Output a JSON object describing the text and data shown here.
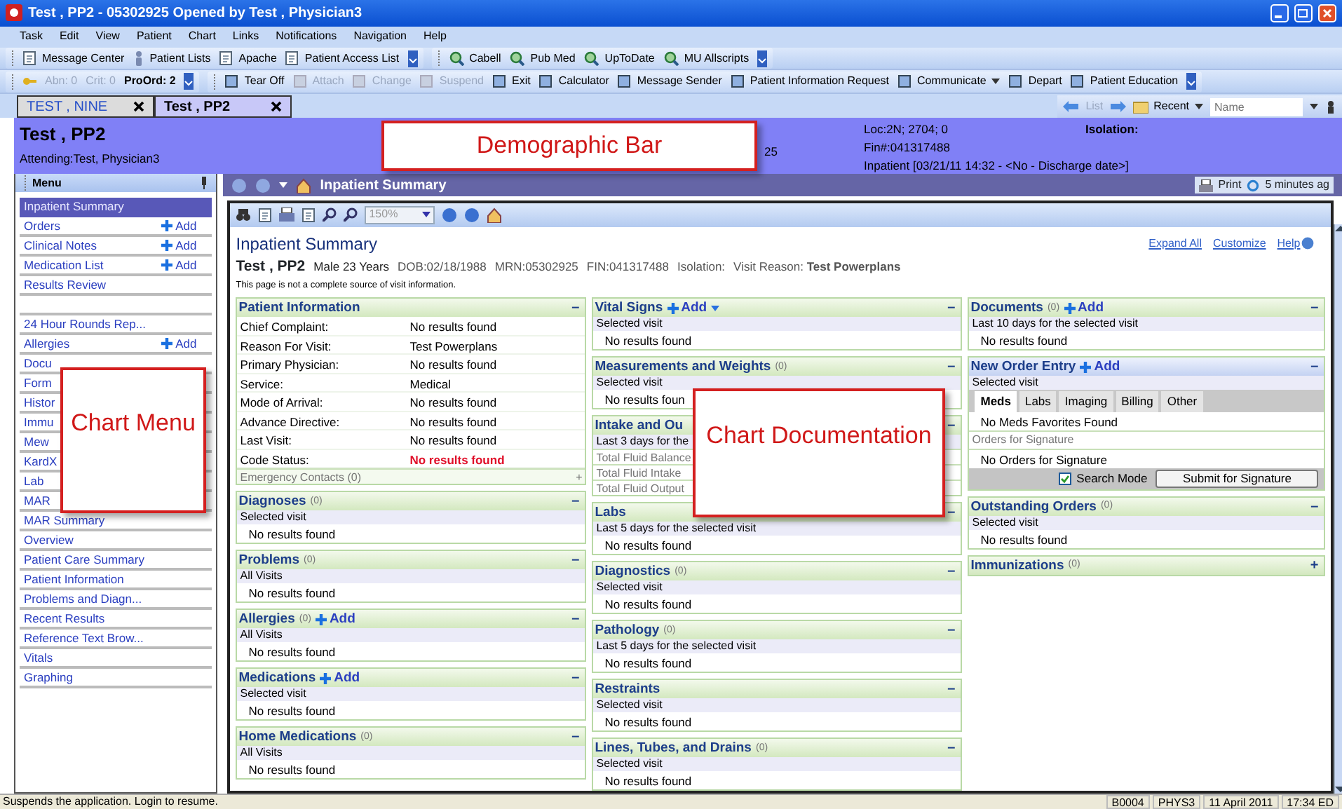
{
  "window": {
    "title": "Test , PP2 - 05302925 Opened by Test , Physician3"
  },
  "menubar": [
    "Task",
    "Edit",
    "View",
    "Patient",
    "Chart",
    "Links",
    "Notifications",
    "Navigation",
    "Help"
  ],
  "toolbar_1": [
    "Message Center",
    "Patient Lists",
    "Apache",
    "Patient Access List"
  ],
  "reference_links": [
    "Cabell",
    "Pub Med",
    "UpToDate",
    "MU Allscripts"
  ],
  "alerts": {
    "abnormal": "Abn: 0",
    "critical": "Crit: 0",
    "proposed_orders": "ProOrd: 2"
  },
  "toolbar_2": [
    {
      "label": "Tear Off",
      "disabled": false,
      "dropdown": false
    },
    {
      "label": "Attach",
      "disabled": true,
      "dropdown": false
    },
    {
      "label": "Change",
      "disabled": true,
      "dropdown": false
    },
    {
      "label": "Suspend",
      "disabled": true,
      "dropdown": false
    },
    {
      "label": "Exit",
      "disabled": false,
      "dropdown": false
    },
    {
      "label": "Calculator",
      "disabled": false,
      "dropdown": false
    },
    {
      "label": "Message Sender",
      "disabled": false,
      "dropdown": false
    },
    {
      "label": "Patient Information Request",
      "disabled": false,
      "dropdown": false
    },
    {
      "label": "Communicate",
      "disabled": false,
      "dropdown": true
    },
    {
      "label": "Depart",
      "disabled": false,
      "dropdown": false
    },
    {
      "label": "Patient Education",
      "disabled": false,
      "dropdown": false
    }
  ],
  "patient_tabs": [
    {
      "label": "TEST , NINE",
      "selected": false
    },
    {
      "label": "Test , PP2",
      "selected": true
    }
  ],
  "patient_nav": {
    "list": "List",
    "recent": "Recent",
    "placeholder": "Name"
  },
  "demographics": {
    "name": "Test , PP2",
    "attending": "Attending:Test, Physician3",
    "partial": "25",
    "location": "Loc:2N; 2704; 0",
    "fin": "Fin#:041317488",
    "encounter": "Inpatient [03/21/11 14:32 - <No - Discharge date>]",
    "isolation": "Isolation:",
    "callout": "Demographic Bar"
  },
  "chart_menu": {
    "title": "Menu",
    "callout": "Chart Menu",
    "items": [
      {
        "kind": "item",
        "label": "Inpatient Summary",
        "selected": true
      },
      {
        "kind": "item",
        "label": "Orders",
        "selected": false,
        "add": "Add"
      },
      {
        "kind": "item",
        "label": "Clinical Notes",
        "selected": false,
        "add": "Add"
      },
      {
        "kind": "item",
        "label": "Medication List",
        "selected": false,
        "add": "Add"
      },
      {
        "kind": "item",
        "label": "Results Review",
        "selected": false
      },
      {
        "kind": "spacer"
      },
      {
        "kind": "item",
        "label": "24 Hour Rounds Rep...",
        "selected": false
      },
      {
        "kind": "item",
        "label": "Allergies",
        "selected": false,
        "add": "Add"
      },
      {
        "kind": "item",
        "label": "Docu",
        "selected": false
      },
      {
        "kind": "item",
        "label": "Form",
        "selected": false
      },
      {
        "kind": "item",
        "label": "Histor",
        "selected": false
      },
      {
        "kind": "item",
        "label": "Immu",
        "selected": false
      },
      {
        "kind": "item",
        "label": "Mew",
        "selected": false
      },
      {
        "kind": "item",
        "label": "KardX",
        "selected": false
      },
      {
        "kind": "item",
        "label": "Lab",
        "selected": false
      },
      {
        "kind": "item",
        "label": "MAR",
        "selected": false
      },
      {
        "kind": "item",
        "label": "MAR Summary",
        "selected": false
      },
      {
        "kind": "item",
        "label": "Overview",
        "selected": false
      },
      {
        "kind": "item",
        "label": "Patient Care Summary",
        "selected": false
      },
      {
        "kind": "item",
        "label": "Patient Information",
        "selected": false
      },
      {
        "kind": "item",
        "label": "Problems and Diagn...",
        "selected": false
      },
      {
        "kind": "item",
        "label": "Recent Results",
        "selected": false
      },
      {
        "kind": "item",
        "label": "Reference Text Brow...",
        "selected": false
      },
      {
        "kind": "item",
        "label": "Vitals",
        "selected": false
      },
      {
        "kind": "item",
        "label": "Graphing",
        "selected": false
      }
    ]
  },
  "main": {
    "title": "Inpatient Summary",
    "print": "Print",
    "refresh": "5 minutes ag",
    "zoom": "150%"
  },
  "summary": {
    "title": "Inpatient Summary",
    "links": [
      "Expand All",
      "Customize",
      "Help"
    ],
    "patient_name": "Test , PP2",
    "details": [
      "Male 23 Years",
      "DOB:02/18/1988",
      "MRN:05302925",
      "FIN:041317488",
      "Isolation:",
      "Visit Reason: **Test Powerplans**"
    ],
    "disclaimer": "This page is not a complete source of visit information.",
    "callout": "Chart Documentation",
    "columns": [
      [
        {
          "kind": "details",
          "title": "Patient Information",
          "toggle": "–",
          "rows": [
            {
              "label": "Chief Complaint:",
              "value": "No results found",
              "alert": false
            },
            {
              "label": "Reason For Visit:",
              "value": "Test Powerplans",
              "alert": false
            },
            {
              "label": "Primary Physician:",
              "value": "No results found",
              "alert": false
            },
            {
              "label": "Service:",
              "value": "Medical",
              "alert": false
            },
            {
              "label": "Mode of Arrival:",
              "value": "No results found",
              "alert": false
            },
            {
              "label": "Advance Directive:",
              "value": "No results found",
              "alert": false
            },
            {
              "label": "Last Visit:",
              "value": "No results found",
              "alert": false
            },
            {
              "label": "Code Status:",
              "value": "No results found",
              "alert": true
            }
          ],
          "footer": {
            "label": "Emergency Contacts (0)",
            "toggle": "+"
          }
        },
        {
          "kind": "list",
          "title": "Diagnoses",
          "count": "(0)",
          "toggle": "–",
          "filter": "Selected visit",
          "empty": "No results found"
        },
        {
          "kind": "list",
          "title": "Problems",
          "count": "(0)",
          "toggle": "–",
          "filter": "All Visits",
          "empty": "No results found"
        },
        {
          "kind": "list",
          "title": "Allergies",
          "count": "(0)",
          "add": "Add",
          "toggle": "–",
          "filter": "All Visits",
          "empty": "No results found"
        },
        {
          "kind": "list",
          "title": "Medications",
          "add": "Add",
          "toggle": "–",
          "filter": "Selected visit",
          "empty": "No results found"
        },
        {
          "kind": "list",
          "title": "Home Medications",
          "count": "(0)",
          "toggle": "–",
          "filter": "All Visits",
          "empty": "No results found"
        }
      ],
      [
        {
          "kind": "list",
          "title": "Vital Signs",
          "add": "Add",
          "add_menu": true,
          "toggle": "–",
          "filter": "Selected visit",
          "empty": "No results found"
        },
        {
          "kind": "list",
          "title": "Measurements and Weights",
          "count": "(0)",
          "toggle": "–",
          "filter": "Selected visit",
          "empty": "No results foun"
        },
        {
          "kind": "list",
          "title": "Intake and Ou",
          "toggle": "–",
          "filter": "Last 3 days for the",
          "lines": [
            "Total Fluid Balance",
            "Total Fluid Intake",
            "Total Fluid Output"
          ]
        },
        {
          "kind": "list",
          "title": "Labs",
          "toggle": "–",
          "filter": "Last 5 days for the selected visit",
          "empty": "No results found"
        },
        {
          "kind": "list",
          "title": "Diagnostics",
          "count": "(0)",
          "toggle": "–",
          "filter": "Selected visit",
          "empty": "No results found"
        },
        {
          "kind": "list",
          "title": "Pathology",
          "count": "(0)",
          "toggle": "–",
          "filter": "Last 5 days for the selected visit",
          "empty": "No results found"
        },
        {
          "kind": "list",
          "title": "Restraints",
          "toggle": "–",
          "filter": "Selected visit",
          "empty": "No results found"
        },
        {
          "kind": "list",
          "title": "Lines, Tubes, and Drains",
          "count": "(0)",
          "toggle": "–",
          "filter": "Selected visit",
          "empty": "No results found"
        }
      ],
      [
        {
          "kind": "list",
          "title": "Documents",
          "count": "(0)",
          "add": "Add",
          "toggle": "–",
          "filter": "Last 10 days for the selected visit",
          "empty": "No results found"
        },
        {
          "kind": "orders",
          "title": "New Order Entry",
          "add": "Add",
          "toggle": "–",
          "filter": "Selected visit",
          "tabs": [
            {
              "label": "Meds",
              "selected": true
            },
            {
              "label": "Labs",
              "selected": false
            },
            {
              "label": "Imaging",
              "selected": false
            },
            {
              "label": "Billing",
              "selected": false
            },
            {
              "label": "Other",
              "selected": false
            }
          ],
          "favorites": "No Meds Favorites Found",
          "signature_header": "Orders for Signature",
          "signature_empty": "No Orders for Signature",
          "search_mode": {
            "label": "Search Mode",
            "checked": true
          },
          "submit": "Submit for Signature"
        },
        {
          "kind": "list",
          "title": "Outstanding Orders",
          "count": "(0)",
          "toggle": "–",
          "filter": "Selected visit",
          "empty": "No results found"
        },
        {
          "kind": "list",
          "title": "Immunizations",
          "count": "(0)",
          "toggle": "+"
        }
      ]
    ]
  },
  "status_bar": {
    "message": "Suspends the application. Login to resume.",
    "cells": [
      "B0004",
      "PHYS3",
      "11 April 2011",
      "17:34 ED"
    ]
  }
}
